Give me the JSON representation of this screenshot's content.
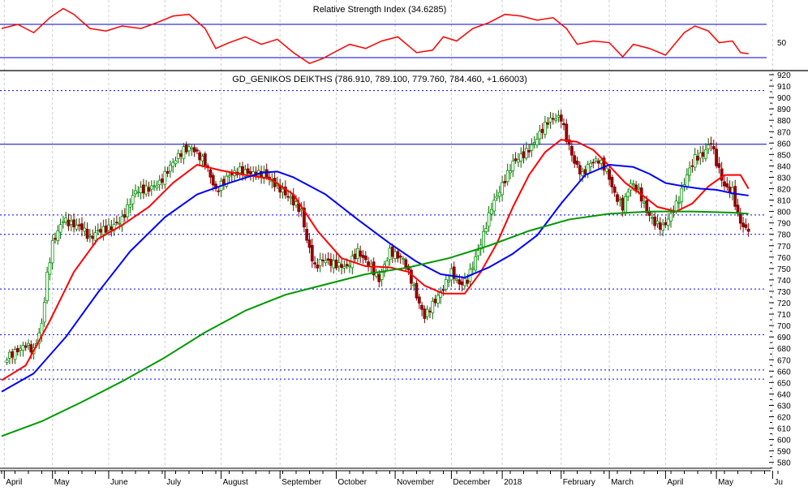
{
  "chart_data": {
    "type": "candlestick",
    "title": "GD_GENIKOS DEIKTHS (786.910, 789.100, 779.760, 784.460, +1.66003)",
    "rsi_title": "Relative Strength Index (34.6285)",
    "ylim": [
      575,
      925
    ],
    "yticks": [
      580,
      590,
      600,
      610,
      620,
      630,
      640,
      650,
      660,
      670,
      680,
      690,
      700,
      710,
      720,
      730,
      740,
      750,
      760,
      770,
      780,
      790,
      800,
      810,
      820,
      830,
      840,
      850,
      860,
      870,
      880,
      890,
      900,
      910,
      920
    ],
    "rsi_ylim": [
      0,
      100
    ],
    "rsi_levels": [
      70,
      30
    ],
    "rsi_tick": "50",
    "xlim": [
      0,
      290
    ],
    "months": [
      {
        "d": 1,
        "label": "April"
      },
      {
        "d": 19,
        "label": "May"
      },
      {
        "d": 40,
        "label": "June"
      },
      {
        "d": 61,
        "label": "July"
      },
      {
        "d": 82,
        "label": "August"
      },
      {
        "d": 104,
        "label": "September"
      },
      {
        "d": 125,
        "label": "October"
      },
      {
        "d": 147,
        "label": "November"
      },
      {
        "d": 168,
        "label": "December"
      },
      {
        "d": 187,
        "label": "2018"
      },
      {
        "d": 209,
        "label": "February"
      },
      {
        "d": 227,
        "label": "March"
      },
      {
        "d": 248,
        "label": "April"
      },
      {
        "d": 267,
        "label": "May"
      },
      {
        "d": 288,
        "label": "Ju"
      }
    ],
    "solid_levels": [
      859
    ],
    "dotted_levels": [
      906,
      797,
      780,
      732,
      692,
      661,
      653
    ],
    "price": [
      [
        2,
        672
      ],
      [
        9,
        683
      ],
      [
        12,
        678
      ],
      [
        15,
        701
      ],
      [
        17,
        744
      ],
      [
        19,
        772
      ],
      [
        23,
        793
      ],
      [
        26,
        789
      ],
      [
        30,
        786
      ],
      [
        33,
        776
      ],
      [
        36,
        783
      ],
      [
        41,
        786
      ],
      [
        45,
        793
      ],
      [
        50,
        818
      ],
      [
        55,
        820
      ],
      [
        59,
        825
      ],
      [
        64,
        843
      ],
      [
        68,
        854
      ],
      [
        71,
        856
      ],
      [
        76,
        843
      ],
      [
        80,
        818
      ],
      [
        85,
        832
      ],
      [
        89,
        836
      ],
      [
        94,
        833
      ],
      [
        98,
        833
      ],
      [
        103,
        822
      ],
      [
        108,
        811
      ],
      [
        112,
        800
      ],
      [
        114,
        775
      ],
      [
        117,
        751
      ],
      [
        120,
        758
      ],
      [
        124,
        754
      ],
      [
        129,
        751
      ],
      [
        133,
        765
      ],
      [
        138,
        751
      ],
      [
        141,
        740
      ],
      [
        145,
        765
      ],
      [
        150,
        758
      ],
      [
        153,
        740
      ],
      [
        156,
        719
      ],
      [
        158,
        708
      ],
      [
        162,
        722
      ],
      [
        165,
        733
      ],
      [
        168,
        747
      ],
      [
        171,
        736
      ],
      [
        174,
        740
      ],
      [
        179,
        772
      ],
      [
        183,
        804
      ],
      [
        186,
        818
      ],
      [
        191,
        843
      ],
      [
        195,
        850
      ],
      [
        198,
        857
      ],
      [
        202,
        872
      ],
      [
        204,
        879
      ],
      [
        206,
        882
      ],
      [
        209,
        882
      ],
      [
        211,
        864
      ],
      [
        214,
        843
      ],
      [
        217,
        832
      ],
      [
        220,
        843
      ],
      [
        223,
        845
      ],
      [
        226,
        836
      ],
      [
        229,
        815
      ],
      [
        232,
        804
      ],
      [
        235,
        825
      ],
      [
        238,
        818
      ],
      [
        241,
        800
      ],
      [
        244,
        790
      ],
      [
        247,
        786
      ],
      [
        250,
        797
      ],
      [
        253,
        811
      ],
      [
        256,
        832
      ],
      [
        259,
        847
      ],
      [
        262,
        850
      ],
      [
        265,
        861
      ],
      [
        267,
        843
      ],
      [
        270,
        822
      ],
      [
        273,
        818
      ],
      [
        275,
        797
      ],
      [
        277,
        786
      ],
      [
        279,
        784.46
      ]
    ],
    "series": [
      {
        "name": "MA short",
        "color": "#ff0000",
        "values": [
          [
            0,
            652
          ],
          [
            9,
            665
          ],
          [
            18,
            704
          ],
          [
            27,
            747
          ],
          [
            36,
            776
          ],
          [
            45,
            788
          ],
          [
            55,
            804
          ],
          [
            64,
            825
          ],
          [
            73,
            841
          ],
          [
            82,
            836
          ],
          [
            91,
            832
          ],
          [
            100,
            829
          ],
          [
            109,
            815
          ],
          [
            118,
            783
          ],
          [
            127,
            759
          ],
          [
            136,
            752
          ],
          [
            145,
            751
          ],
          [
            152,
            747
          ],
          [
            158,
            735
          ],
          [
            165,
            728
          ],
          [
            173,
            728
          ],
          [
            179,
            747
          ],
          [
            185,
            772
          ],
          [
            191,
            804
          ],
          [
            197,
            832
          ],
          [
            203,
            852
          ],
          [
            209,
            863
          ],
          [
            215,
            861
          ],
          [
            221,
            854
          ],
          [
            227,
            840
          ],
          [
            233,
            825
          ],
          [
            239,
            815
          ],
          [
            245,
            804
          ],
          [
            252,
            800
          ],
          [
            258,
            807
          ],
          [
            264,
            822
          ],
          [
            270,
            832
          ],
          [
            276,
            832
          ],
          [
            279,
            820
          ]
        ]
      },
      {
        "name": "MA medium",
        "color": "#0000ff",
        "values": [
          [
            0,
            642
          ],
          [
            12,
            658
          ],
          [
            24,
            690
          ],
          [
            36,
            729
          ],
          [
            48,
            765
          ],
          [
            61,
            795
          ],
          [
            73,
            815
          ],
          [
            85,
            825
          ],
          [
            97,
            834
          ],
          [
            103,
            835
          ],
          [
            109,
            830
          ],
          [
            121,
            815
          ],
          [
            133,
            793
          ],
          [
            145,
            772
          ],
          [
            155,
            756
          ],
          [
            164,
            745
          ],
          [
            173,
            742
          ],
          [
            182,
            751
          ],
          [
            191,
            763
          ],
          [
            200,
            779
          ],
          [
            209,
            807
          ],
          [
            218,
            832
          ],
          [
            227,
            841
          ],
          [
            236,
            839
          ],
          [
            242,
            833
          ],
          [
            248,
            825
          ],
          [
            255,
            822
          ],
          [
            261,
            820
          ],
          [
            267,
            819
          ],
          [
            273,
            816
          ],
          [
            279,
            814
          ]
        ]
      },
      {
        "name": "MA long",
        "color": "#009900",
        "values": [
          [
            0,
            603
          ],
          [
            15,
            616
          ],
          [
            30,
            633
          ],
          [
            45,
            651
          ],
          [
            61,
            672
          ],
          [
            76,
            694
          ],
          [
            91,
            713
          ],
          [
            106,
            727
          ],
          [
            121,
            736
          ],
          [
            136,
            745
          ],
          [
            152,
            751
          ],
          [
            167,
            759
          ],
          [
            182,
            770
          ],
          [
            197,
            783
          ],
          [
            212,
            793
          ],
          [
            227,
            798
          ],
          [
            242,
            800
          ],
          [
            258,
            800
          ],
          [
            273,
            799
          ],
          [
            279,
            798
          ]
        ]
      }
    ],
    "rsi": [
      [
        0,
        65
      ],
      [
        6,
        70
      ],
      [
        12,
        60
      ],
      [
        18,
        78
      ],
      [
        23,
        89
      ],
      [
        27,
        82
      ],
      [
        33,
        65
      ],
      [
        39,
        62
      ],
      [
        45,
        68
      ],
      [
        52,
        65
      ],
      [
        58,
        72
      ],
      [
        64,
        80
      ],
      [
        70,
        82
      ],
      [
        76,
        65
      ],
      [
        80,
        41
      ],
      [
        85,
        48
      ],
      [
        91,
        55
      ],
      [
        97,
        46
      ],
      [
        103,
        52
      ],
      [
        109,
        36
      ],
      [
        115,
        23
      ],
      [
        120,
        29
      ],
      [
        124,
        36
      ],
      [
        130,
        46
      ],
      [
        136,
        41
      ],
      [
        142,
        50
      ],
      [
        148,
        55
      ],
      [
        155,
        36
      ],
      [
        161,
        39
      ],
      [
        165,
        55
      ],
      [
        170,
        50
      ],
      [
        176,
        65
      ],
      [
        182,
        72
      ],
      [
        188,
        82
      ],
      [
        194,
        80
      ],
      [
        200,
        75
      ],
      [
        206,
        78
      ],
      [
        211,
        65
      ],
      [
        215,
        46
      ],
      [
        221,
        50
      ],
      [
        227,
        48
      ],
      [
        232,
        31
      ],
      [
        236,
        46
      ],
      [
        242,
        41
      ],
      [
        248,
        33
      ],
      [
        255,
        60
      ],
      [
        259,
        68
      ],
      [
        264,
        62
      ],
      [
        268,
        48
      ],
      [
        273,
        50
      ],
      [
        276,
        36
      ],
      [
        279,
        34.6
      ]
    ]
  }
}
